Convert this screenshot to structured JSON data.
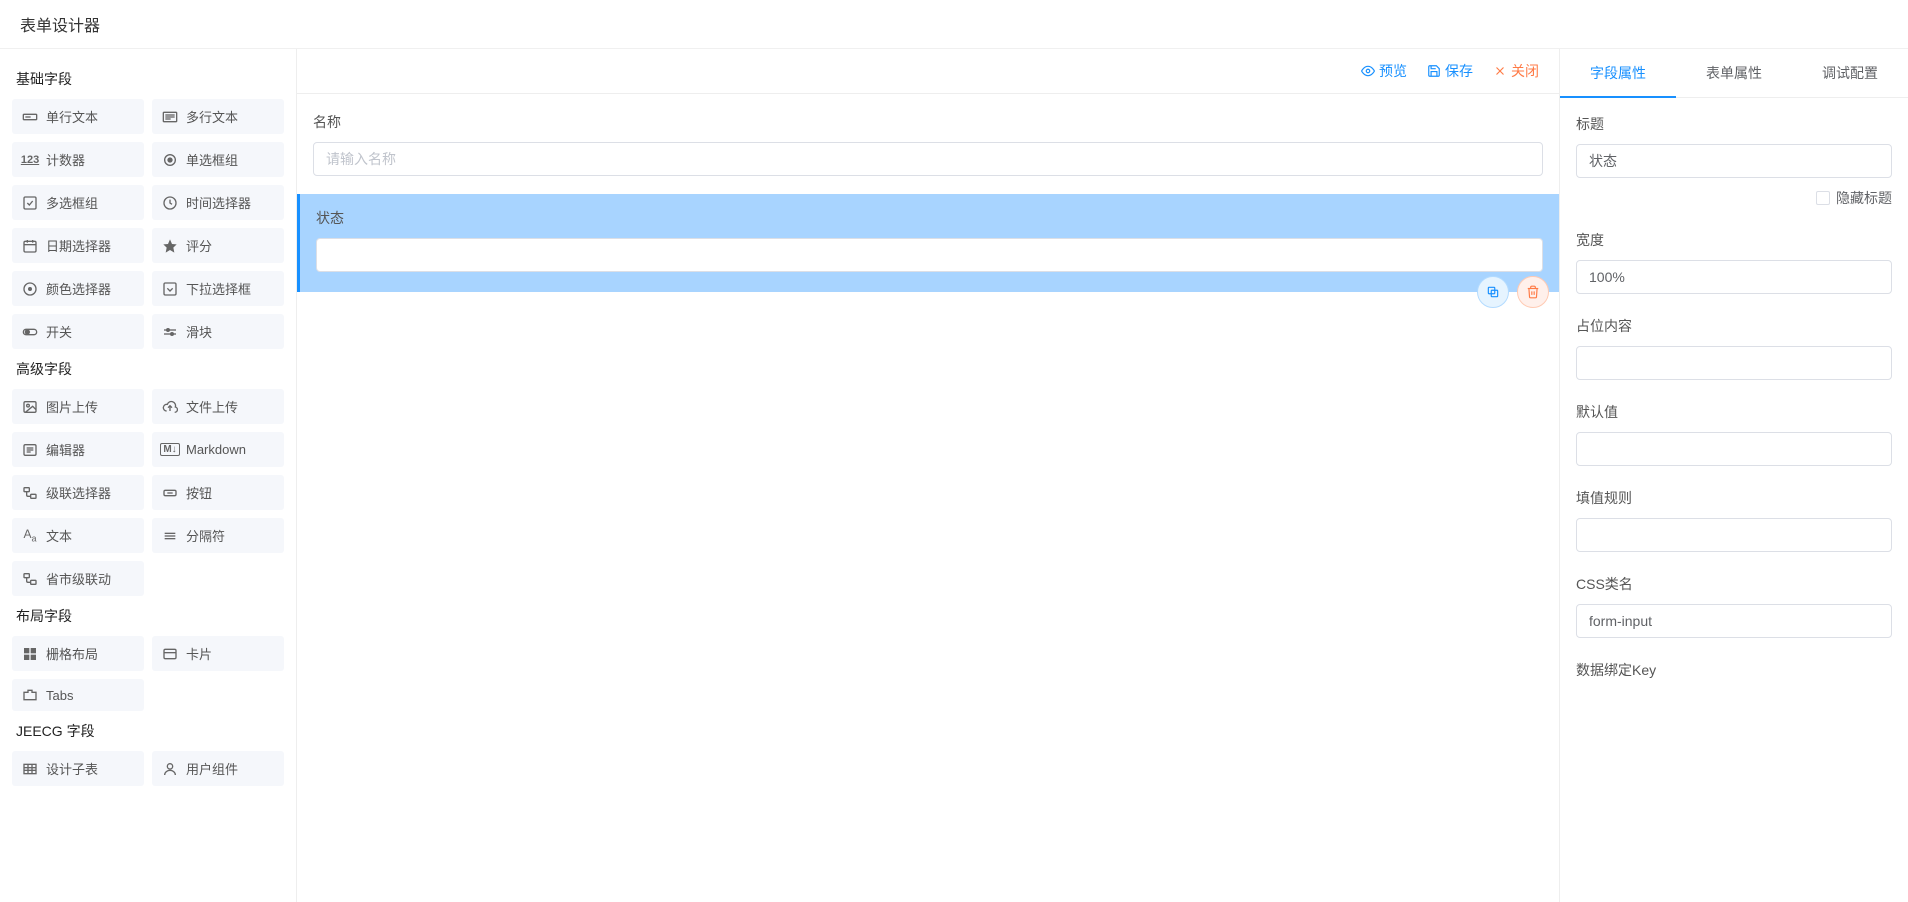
{
  "header": {
    "title": "表单设计器"
  },
  "sidebar": {
    "groups": [
      {
        "title": "基础字段",
        "items": [
          {
            "label": "单行文本",
            "icon": "text-input-icon"
          },
          {
            "label": "多行文本",
            "icon": "textarea-icon"
          },
          {
            "label": "计数器",
            "icon": "number-icon"
          },
          {
            "label": "单选框组",
            "icon": "radio-icon"
          },
          {
            "label": "多选框组",
            "icon": "checkbox-icon"
          },
          {
            "label": "时间选择器",
            "icon": "clock-icon"
          },
          {
            "label": "日期选择器",
            "icon": "calendar-icon"
          },
          {
            "label": "评分",
            "icon": "star-icon"
          },
          {
            "label": "颜色选择器",
            "icon": "color-icon"
          },
          {
            "label": "下拉选择框",
            "icon": "select-icon"
          },
          {
            "label": "开关",
            "icon": "switch-icon"
          },
          {
            "label": "滑块",
            "icon": "slider-icon"
          }
        ]
      },
      {
        "title": "高级字段",
        "items": [
          {
            "label": "图片上传",
            "icon": "image-icon"
          },
          {
            "label": "文件上传",
            "icon": "upload-icon"
          },
          {
            "label": "编辑器",
            "icon": "editor-icon"
          },
          {
            "label": "Markdown",
            "icon": "markdown-icon"
          },
          {
            "label": "级联选择器",
            "icon": "cascader-icon"
          },
          {
            "label": "按钮",
            "icon": "button-icon"
          },
          {
            "label": "文本",
            "icon": "font-icon"
          },
          {
            "label": "分隔符",
            "icon": "divider-icon"
          },
          {
            "label": "省市级联动",
            "icon": "cascader-icon"
          }
        ]
      },
      {
        "title": "布局字段",
        "items": [
          {
            "label": "栅格布局",
            "icon": "grid-icon"
          },
          {
            "label": "卡片",
            "icon": "card-icon"
          },
          {
            "label": "Tabs",
            "icon": "tabs-icon"
          }
        ]
      },
      {
        "title": "JEECG 字段",
        "items": [
          {
            "label": "设计子表",
            "icon": "table-icon"
          },
          {
            "label": "用户组件",
            "icon": "user-icon"
          }
        ]
      }
    ]
  },
  "topbar": {
    "preview": "预览",
    "save": "保存",
    "close": "关闭"
  },
  "canvas": {
    "fields": [
      {
        "label": "名称",
        "placeholder": "请输入名称",
        "selected": false
      },
      {
        "label": "状态",
        "placeholder": "",
        "selected": true
      }
    ]
  },
  "props": {
    "tabs": [
      {
        "label": "字段属性",
        "active": true
      },
      {
        "label": "表单属性",
        "active": false
      },
      {
        "label": "调试配置",
        "active": false
      }
    ],
    "title_label": "标题",
    "title_value": "状态",
    "hide_title_label": "隐藏标题",
    "hide_title_checked": false,
    "width_label": "宽度",
    "width_value": "100%",
    "placeholder_label": "占位内容",
    "placeholder_value": "",
    "default_label": "默认值",
    "default_value": "",
    "fill_rule_label": "填值规则",
    "fill_rule_value": "",
    "css_class_label": "CSS类名",
    "css_class_value": "form-input",
    "data_bind_key_label": "数据绑定Key"
  },
  "icons": {
    "text-input-icon": "rect-line",
    "textarea-icon": "rect-lines",
    "number-icon": "123",
    "radio-icon": "radio",
    "checkbox-icon": "check",
    "clock-icon": "clock",
    "calendar-icon": "calendar",
    "star-icon": "star",
    "color-icon": "circle-dot",
    "select-icon": "select",
    "switch-icon": "switch",
    "slider-icon": "slider",
    "image-icon": "image",
    "upload-icon": "cloud-up",
    "editor-icon": "edit-box",
    "markdown-icon": "md",
    "cascader-icon": "cascade",
    "button-icon": "btn",
    "font-icon": "Aa",
    "divider-icon": "lines",
    "grid-icon": "grid",
    "card-icon": "card",
    "tabs-icon": "tabs",
    "table-icon": "table",
    "user-icon": "user"
  }
}
